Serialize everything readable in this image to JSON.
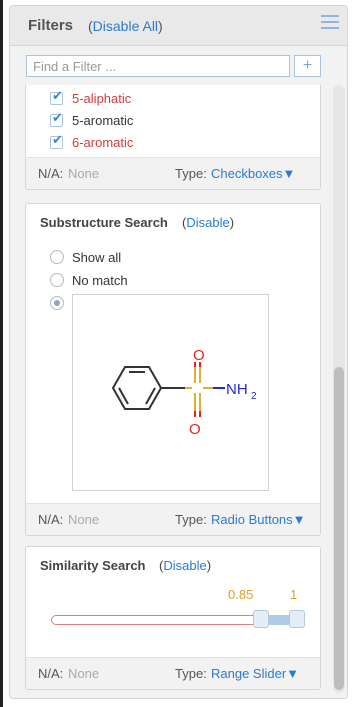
{
  "header": {
    "title": "Filters",
    "disable_all_open": "(",
    "disable_all_link": "Disable All",
    "disable_all_close": ")"
  },
  "search": {
    "placeholder": "Find a Filter ...",
    "add_label": "+"
  },
  "checkbox_filter": {
    "items": [
      {
        "label": "5-aliphatic",
        "checked": true,
        "color": "#d43c3c"
      },
      {
        "label": "5-aromatic",
        "checked": true,
        "color": "#333333"
      },
      {
        "label": "6-aromatic",
        "checked": true,
        "color": "#d43c3c"
      }
    ],
    "na_label": "N/A:",
    "na_value": "None",
    "type_label": "Type:",
    "type_value": "Checkboxes▼"
  },
  "substructure_filter": {
    "title": "Substructure Search",
    "disable_open": "(",
    "disable_link": "Disable",
    "disable_close": ")",
    "options": [
      {
        "label": "Show all",
        "selected": false
      },
      {
        "label": "No match",
        "selected": false
      },
      {
        "label": "",
        "selected": true
      }
    ],
    "molecule": {
      "oxygen_label": "O",
      "amine_label": "NH",
      "amine_subscript": "2"
    },
    "na_label": "N/A:",
    "na_value": "None",
    "type_label": "Type:",
    "type_value": "Radio Buttons▼"
  },
  "similarity_filter": {
    "title": "Similarity Search",
    "disable_open": "(",
    "disable_link": "Disable",
    "disable_close": ")",
    "range_min": 0,
    "range_max": 1,
    "low_value": 0.85,
    "high_value": 1,
    "low_label": "0.85",
    "high_label": "1",
    "na_label": "N/A:",
    "na_value": "None",
    "type_label": "Type:",
    "type_value": "Range Slider▼"
  },
  "colors": {
    "link": "#2a7bd4",
    "slider_value": "#e0a020",
    "oxygen": "#e02424",
    "nitrogen": "#2828d0",
    "sulfur": "#e0b030"
  }
}
